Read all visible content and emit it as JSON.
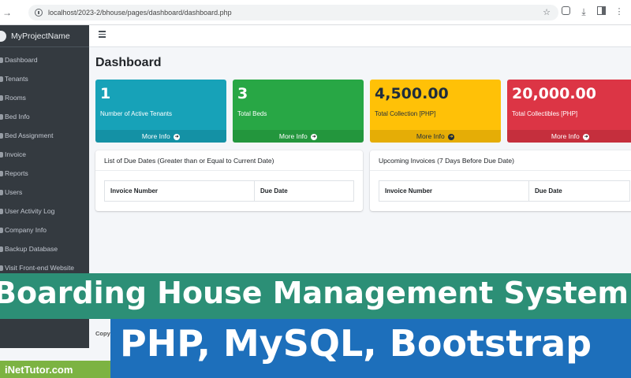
{
  "browser": {
    "url": "localhost/2023-2/bhouse/pages/dashboard/dashboard.php"
  },
  "sidebar": {
    "brand": "MyProjectName",
    "items": [
      {
        "label": "Dashboard"
      },
      {
        "label": "Tenants"
      },
      {
        "label": "Rooms"
      },
      {
        "label": "Bed Info"
      },
      {
        "label": "Bed Assignment"
      },
      {
        "label": "Invoice"
      },
      {
        "label": "Reports"
      },
      {
        "label": "Users"
      },
      {
        "label": "User Activity Log"
      },
      {
        "label": "Company Info"
      },
      {
        "label": "Backup Database"
      },
      {
        "label": "Visit Front-end Website"
      }
    ]
  },
  "main": {
    "title": "Dashboard",
    "stat_boxes": [
      {
        "value": "1",
        "label": "Number of Active Tenants",
        "more": "More Info",
        "color": "#17a2b8"
      },
      {
        "value": "3",
        "label": "Total Beds",
        "more": "More Info",
        "color": "#28a745"
      },
      {
        "value": "4,500.00",
        "label": "Total Collection [PHP]",
        "more": "More Info",
        "color": "#ffc107"
      },
      {
        "value": "20,000.00",
        "label": "Total Collectibles [PHP]",
        "more": "More Info",
        "color": "#dc3545"
      }
    ],
    "due_dates_card": {
      "title": "List of Due Dates (Greater than or Equal to Current Date)",
      "columns": [
        "Invoice Number",
        "Due Date"
      ]
    },
    "upcoming_card": {
      "title": "Upcoming Invoices (7 Days Before Due Date)",
      "columns": [
        "Invoice Number",
        "Due Date"
      ]
    },
    "footer_copy": "Copy"
  },
  "overlay": {
    "headline": "Boarding House Management System",
    "subheadline": "PHP, MySQL, Bootstrap",
    "brand": "iNetTutor.com"
  }
}
